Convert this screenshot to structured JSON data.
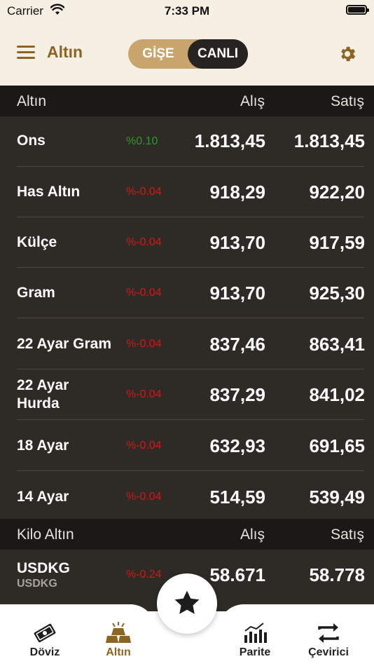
{
  "status": {
    "carrier": "Carrier",
    "time": "7:33 PM"
  },
  "header": {
    "title": "Altın",
    "toggle": {
      "gise": "GİŞE",
      "canli": "CANLI"
    }
  },
  "gold_table": {
    "headers": {
      "name": "Altın",
      "buy": "Alış",
      "sell": "Satış"
    },
    "rows": [
      {
        "name": "Ons",
        "change": "%0.10",
        "buy": "1.813,45",
        "sell": "1.813,45",
        "trend": "up"
      },
      {
        "name": "Has Altın",
        "change": "%-0.04",
        "buy": "918,29",
        "sell": "922,20",
        "trend": "down"
      },
      {
        "name": "Külçe",
        "change": "%-0.04",
        "buy": "913,70",
        "sell": "917,59",
        "trend": "down"
      },
      {
        "name": "Gram",
        "change": "%-0.04",
        "buy": "913,70",
        "sell": "925,30",
        "trend": "down"
      },
      {
        "name": "22 Ayar Gram",
        "change": "%-0.04",
        "buy": "837,46",
        "sell": "863,41",
        "trend": "down"
      },
      {
        "name": "22 Ayar Hurda",
        "change": "%-0.04",
        "buy": "837,29",
        "sell": "841,02",
        "trend": "down"
      },
      {
        "name": "18 Ayar",
        "change": "%-0.04",
        "buy": "632,93",
        "sell": "691,65",
        "trend": "down"
      },
      {
        "name": "14 Ayar",
        "change": "%-0.04",
        "buy": "514,59",
        "sell": "539,49",
        "trend": "down"
      }
    ]
  },
  "kilo_table": {
    "headers": {
      "name": "Kilo Altın",
      "buy": "Alış",
      "sell": "Satış"
    },
    "rows": [
      {
        "name": "USDKG",
        "subtitle": "USDKG",
        "change": "%-0.24",
        "buy": "58.671",
        "sell": "58.778",
        "trend": "down"
      }
    ]
  },
  "tabbar": {
    "items": [
      {
        "label": "Döviz",
        "icon": "money-icon"
      },
      {
        "label": "Altın",
        "icon": "gold-bars-icon",
        "active": true
      },
      {
        "label": "Parite",
        "icon": "bar-chart-icon"
      },
      {
        "label": "Çevirici",
        "icon": "exchange-arrows-icon"
      }
    ],
    "center": {
      "icon": "star-icon"
    }
  },
  "colors": {
    "accent": "#8c6424",
    "toggle_bg": "#c9a56d",
    "header_bg": "#f6efe3",
    "table_bg": "#2e2b27",
    "positive": "#2a9a2a",
    "negative": "#d21818"
  }
}
